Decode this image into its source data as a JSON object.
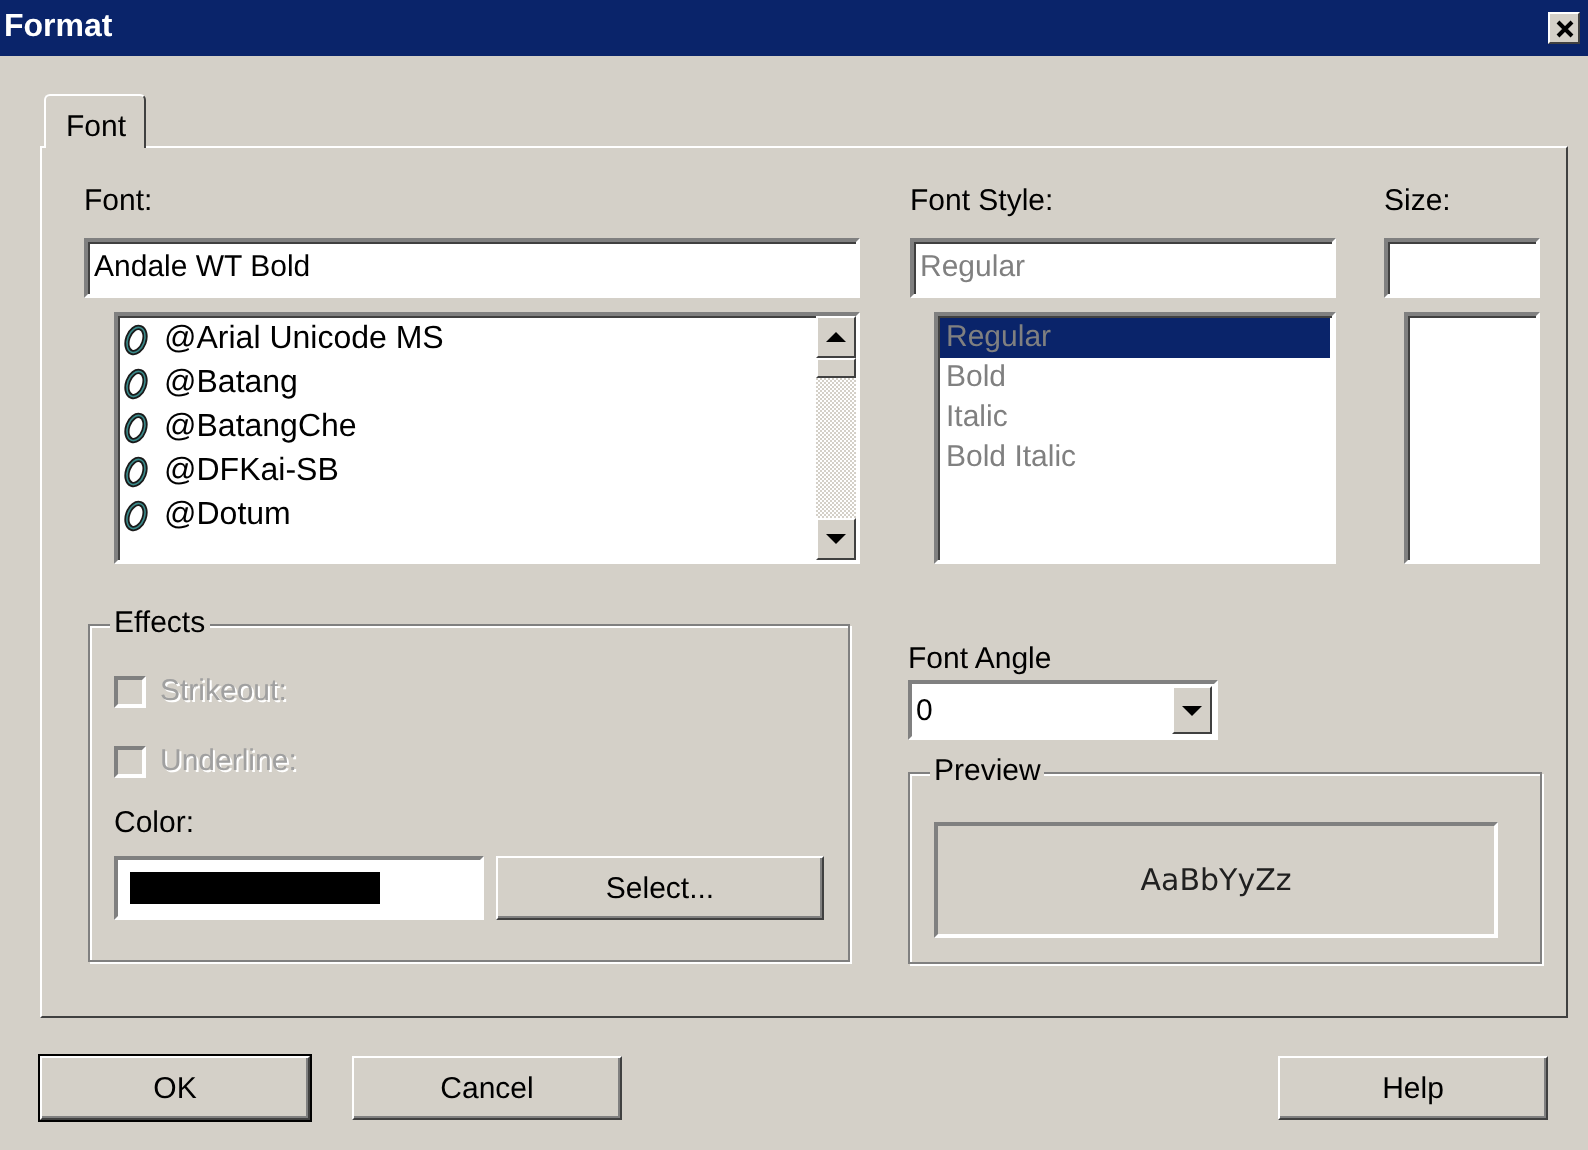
{
  "window": {
    "title": "Format"
  },
  "tabs": [
    {
      "label": "Font",
      "selected": true
    }
  ],
  "font": {
    "label": "Font:",
    "value": "Andale WT Bold",
    "items": [
      {
        "name": "@Arial Unicode MS",
        "selected": false
      },
      {
        "name": "@Batang",
        "selected": false
      },
      {
        "name": "@BatangChe",
        "selected": false
      },
      {
        "name": "@DFKai-SB",
        "selected": false
      },
      {
        "name": "@Dotum",
        "selected": false
      }
    ]
  },
  "font_style": {
    "label": "Font Style:",
    "value": "Regular",
    "disabled": true,
    "items": [
      {
        "name": "Regular",
        "selected": true
      },
      {
        "name": "Bold",
        "selected": false
      },
      {
        "name": "Italic",
        "selected": false
      },
      {
        "name": "Bold Italic",
        "selected": false
      }
    ]
  },
  "size": {
    "label": "Size:"
  },
  "effects": {
    "title": "Effects",
    "checkboxes": [
      {
        "label": "Strikeout:",
        "checked": false,
        "disabled": true
      },
      {
        "label": "Underline:",
        "checked": false,
        "disabled": true
      }
    ],
    "color_label": "Color:",
    "color": "#000000",
    "select_button": "Select..."
  },
  "font_angle": {
    "label": "Font Angle",
    "value": "0"
  },
  "preview": {
    "title": "Preview",
    "sample": "AaBbYyZz"
  },
  "buttons": [
    {
      "label": "OK",
      "default": true
    },
    {
      "label": "Cancel",
      "default": false
    },
    {
      "label": "Help",
      "default": false
    }
  ]
}
